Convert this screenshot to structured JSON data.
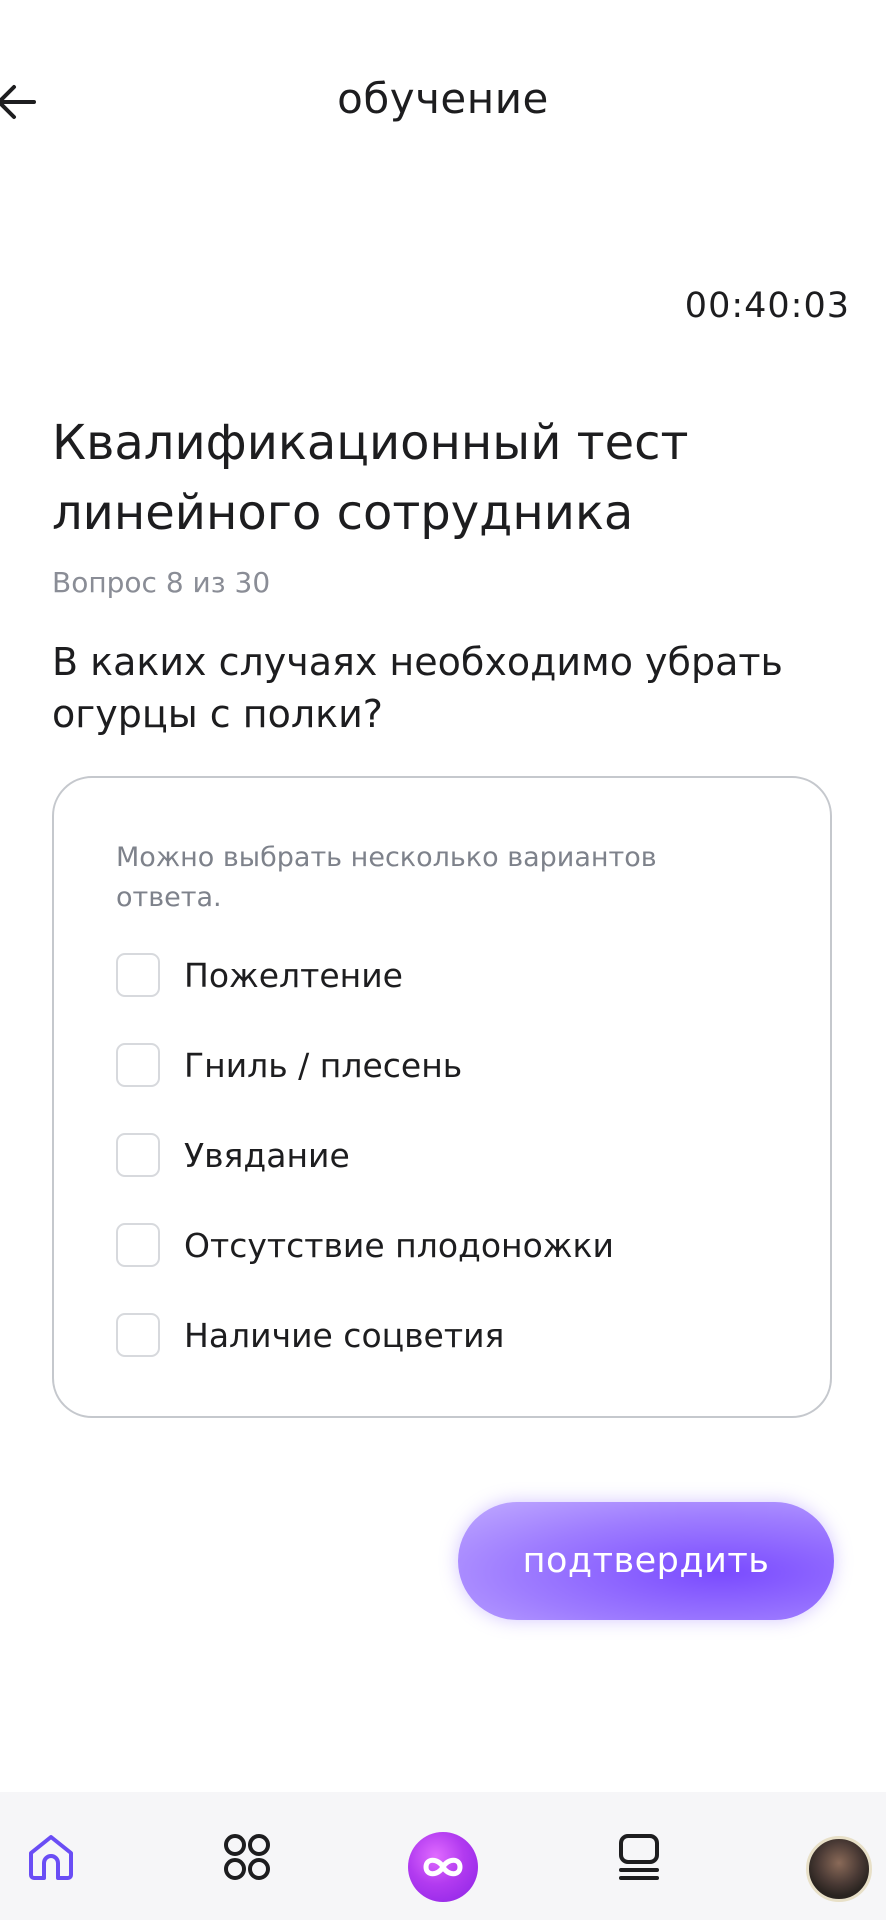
{
  "header": {
    "title": "обучение"
  },
  "timer": "00:40:03",
  "test": {
    "title": "Квалификационный тест линейного сотрудника",
    "counter": "Вопрос 8 из 30",
    "question": "В каких случаях необходимо убрать огурцы с полки?"
  },
  "options": {
    "hint": "Можно выбрать несколько вариантов ответа.",
    "items": [
      {
        "label": "Пожелтение",
        "checked": false
      },
      {
        "label": "Гниль / плесень",
        "checked": false
      },
      {
        "label": "Увядание",
        "checked": false
      },
      {
        "label": "Отсутствие плодоножки",
        "checked": false
      },
      {
        "label": "Наличие соцветия",
        "checked": false
      }
    ]
  },
  "submit_label": "подтвердить",
  "colors": {
    "accent": "#7a4bff",
    "accent_light": "#c0aaff",
    "nav_active": "#6a4df5",
    "center_button": "#b23bf0",
    "text_secondary": "#8a8d96"
  },
  "bottom_nav": {
    "items": [
      {
        "icon": "home-icon",
        "active": true
      },
      {
        "icon": "grid-icon",
        "active": false
      },
      {
        "icon": "infinity-icon",
        "active": false
      },
      {
        "icon": "list-icon",
        "active": false
      },
      {
        "icon": "avatar",
        "active": false
      }
    ]
  }
}
